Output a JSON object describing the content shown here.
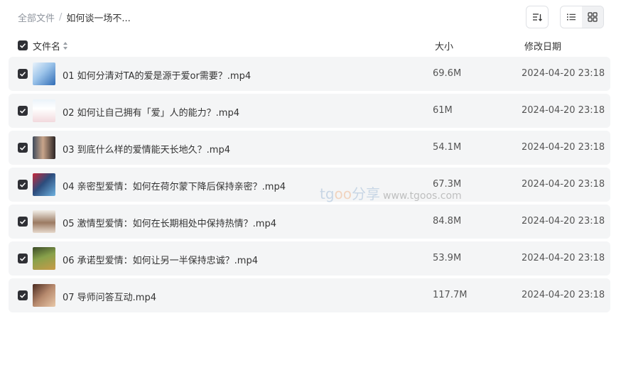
{
  "breadcrumb": {
    "root": "全部文件",
    "separator": "/",
    "current": "如何谈一场不..."
  },
  "toolbar": {
    "sort_icon": "sort-desc-icon",
    "view_list_icon": "list-view-icon",
    "view_grid_icon": "grid-view-icon",
    "active_view": "grid"
  },
  "table": {
    "headers": {
      "name": "文件名",
      "size": "大小",
      "date": "修改日期"
    },
    "select_all_checked": true,
    "rows": [
      {
        "name": "01 如何分清对TA的爱是源于爱or需要？.mp4",
        "size": "69.6M",
        "date": "2024-04-20 23:18",
        "checked": true
      },
      {
        "name": "02 如何让自己拥有「爱」人的能力？.mp4",
        "size": "61M",
        "date": "2024-04-20 23:18",
        "checked": true
      },
      {
        "name": "03 到底什么样的爱情能天长地久？.mp4",
        "size": "54.1M",
        "date": "2024-04-20 23:18",
        "checked": true
      },
      {
        "name": "04 亲密型爱情：如何在荷尔蒙下降后保持亲密？.mp4",
        "size": "67.3M",
        "date": "2024-04-20 23:18",
        "checked": true
      },
      {
        "name": "05 激情型爱情：如何在长期相处中保持热情？.mp4",
        "size": "84.8M",
        "date": "2024-04-20 23:18",
        "checked": true
      },
      {
        "name": "06 承诺型爱情：如何让另一半保持忠诚？.mp4",
        "size": "53.9M",
        "date": "2024-04-20 23:18",
        "checked": true
      },
      {
        "name": "07 导师问答互动.mp4",
        "size": "117.7M",
        "date": "2024-04-20 23:18",
        "checked": true
      }
    ]
  },
  "watermark": {
    "brand_prefix": "tg",
    "brand_oo": "oo",
    "brand_suffix": "分享",
    "url": "www.tgoos.com"
  },
  "colors": {
    "checkbox": "#2f3035",
    "row_background": "#f4f5f6",
    "muted_text": "#8f959e"
  }
}
